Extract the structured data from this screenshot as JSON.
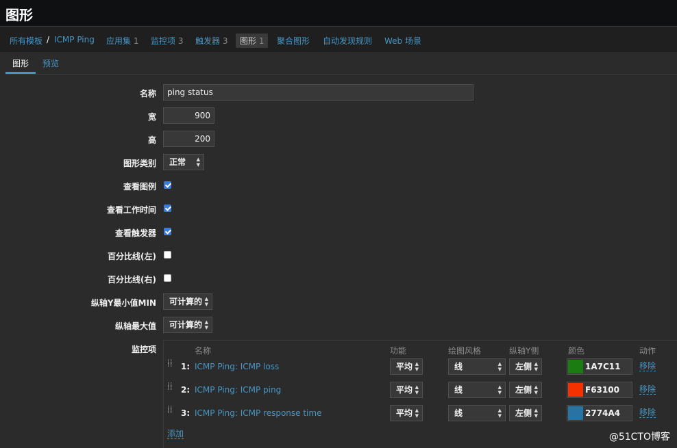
{
  "page": {
    "title": "图形"
  },
  "breadcrumbs": {
    "all_templates": "所有模板",
    "separator": "/",
    "template": "ICMP Ping",
    "applications": {
      "label": "应用集",
      "count": "1"
    },
    "items": {
      "label": "监控项",
      "count": "3"
    },
    "triggers": {
      "label": "触发器",
      "count": "3"
    },
    "graphs": {
      "label": "图形",
      "count": "1"
    },
    "screens": "聚合图形",
    "discovery": "自动发现规则",
    "web": "Web 场景"
  },
  "tabs": [
    {
      "label": "图形"
    },
    {
      "label": "预览"
    }
  ],
  "form": {
    "name": {
      "label": "名称",
      "value": "ping status"
    },
    "width": {
      "label": "宽",
      "value": "900"
    },
    "height": {
      "label": "高",
      "value": "200"
    },
    "graph_type": {
      "label": "图形类别",
      "value": "正常"
    },
    "show_legend": {
      "label": "查看图例",
      "checked": true
    },
    "show_working_time": {
      "label": "查看工作时间",
      "checked": true
    },
    "show_triggers": {
      "label": "查看触发器",
      "checked": true
    },
    "percentile_left": {
      "label": "百分比线(左)",
      "checked": false
    },
    "percentile_right": {
      "label": "百分比线(右)",
      "checked": false
    },
    "y_min": {
      "label": "纵轴Y最小值MIN",
      "value": "可计算的"
    },
    "y_max": {
      "label": "纵轴最大值",
      "value": "可计算的"
    },
    "items_label": "监控项"
  },
  "items_table": {
    "headers": {
      "name": "名称",
      "function": "功能",
      "draw_style": "绘图风格",
      "y_axis": "纵轴Y侧",
      "color": "颜色",
      "action": "动作"
    },
    "rows": [
      {
        "num": "1:",
        "name": "ICMP Ping: ICMP loss",
        "function": "平均",
        "draw_style": "线",
        "y_axis": "左侧",
        "color": "1A7C11",
        "color_hex": "#1A7C11",
        "action": "移除"
      },
      {
        "num": "2:",
        "name": "ICMP Ping: ICMP ping",
        "function": "平均",
        "draw_style": "线",
        "y_axis": "左侧",
        "color": "F63100",
        "color_hex": "#F63100",
        "action": "移除"
      },
      {
        "num": "3:",
        "name": "ICMP Ping: ICMP response time",
        "function": "平均",
        "draw_style": "线",
        "y_axis": "左侧",
        "color": "2774A4",
        "color_hex": "#2774A4",
        "action": "移除"
      }
    ],
    "add_label": "添加"
  },
  "watermark": "@51CTO博客"
}
